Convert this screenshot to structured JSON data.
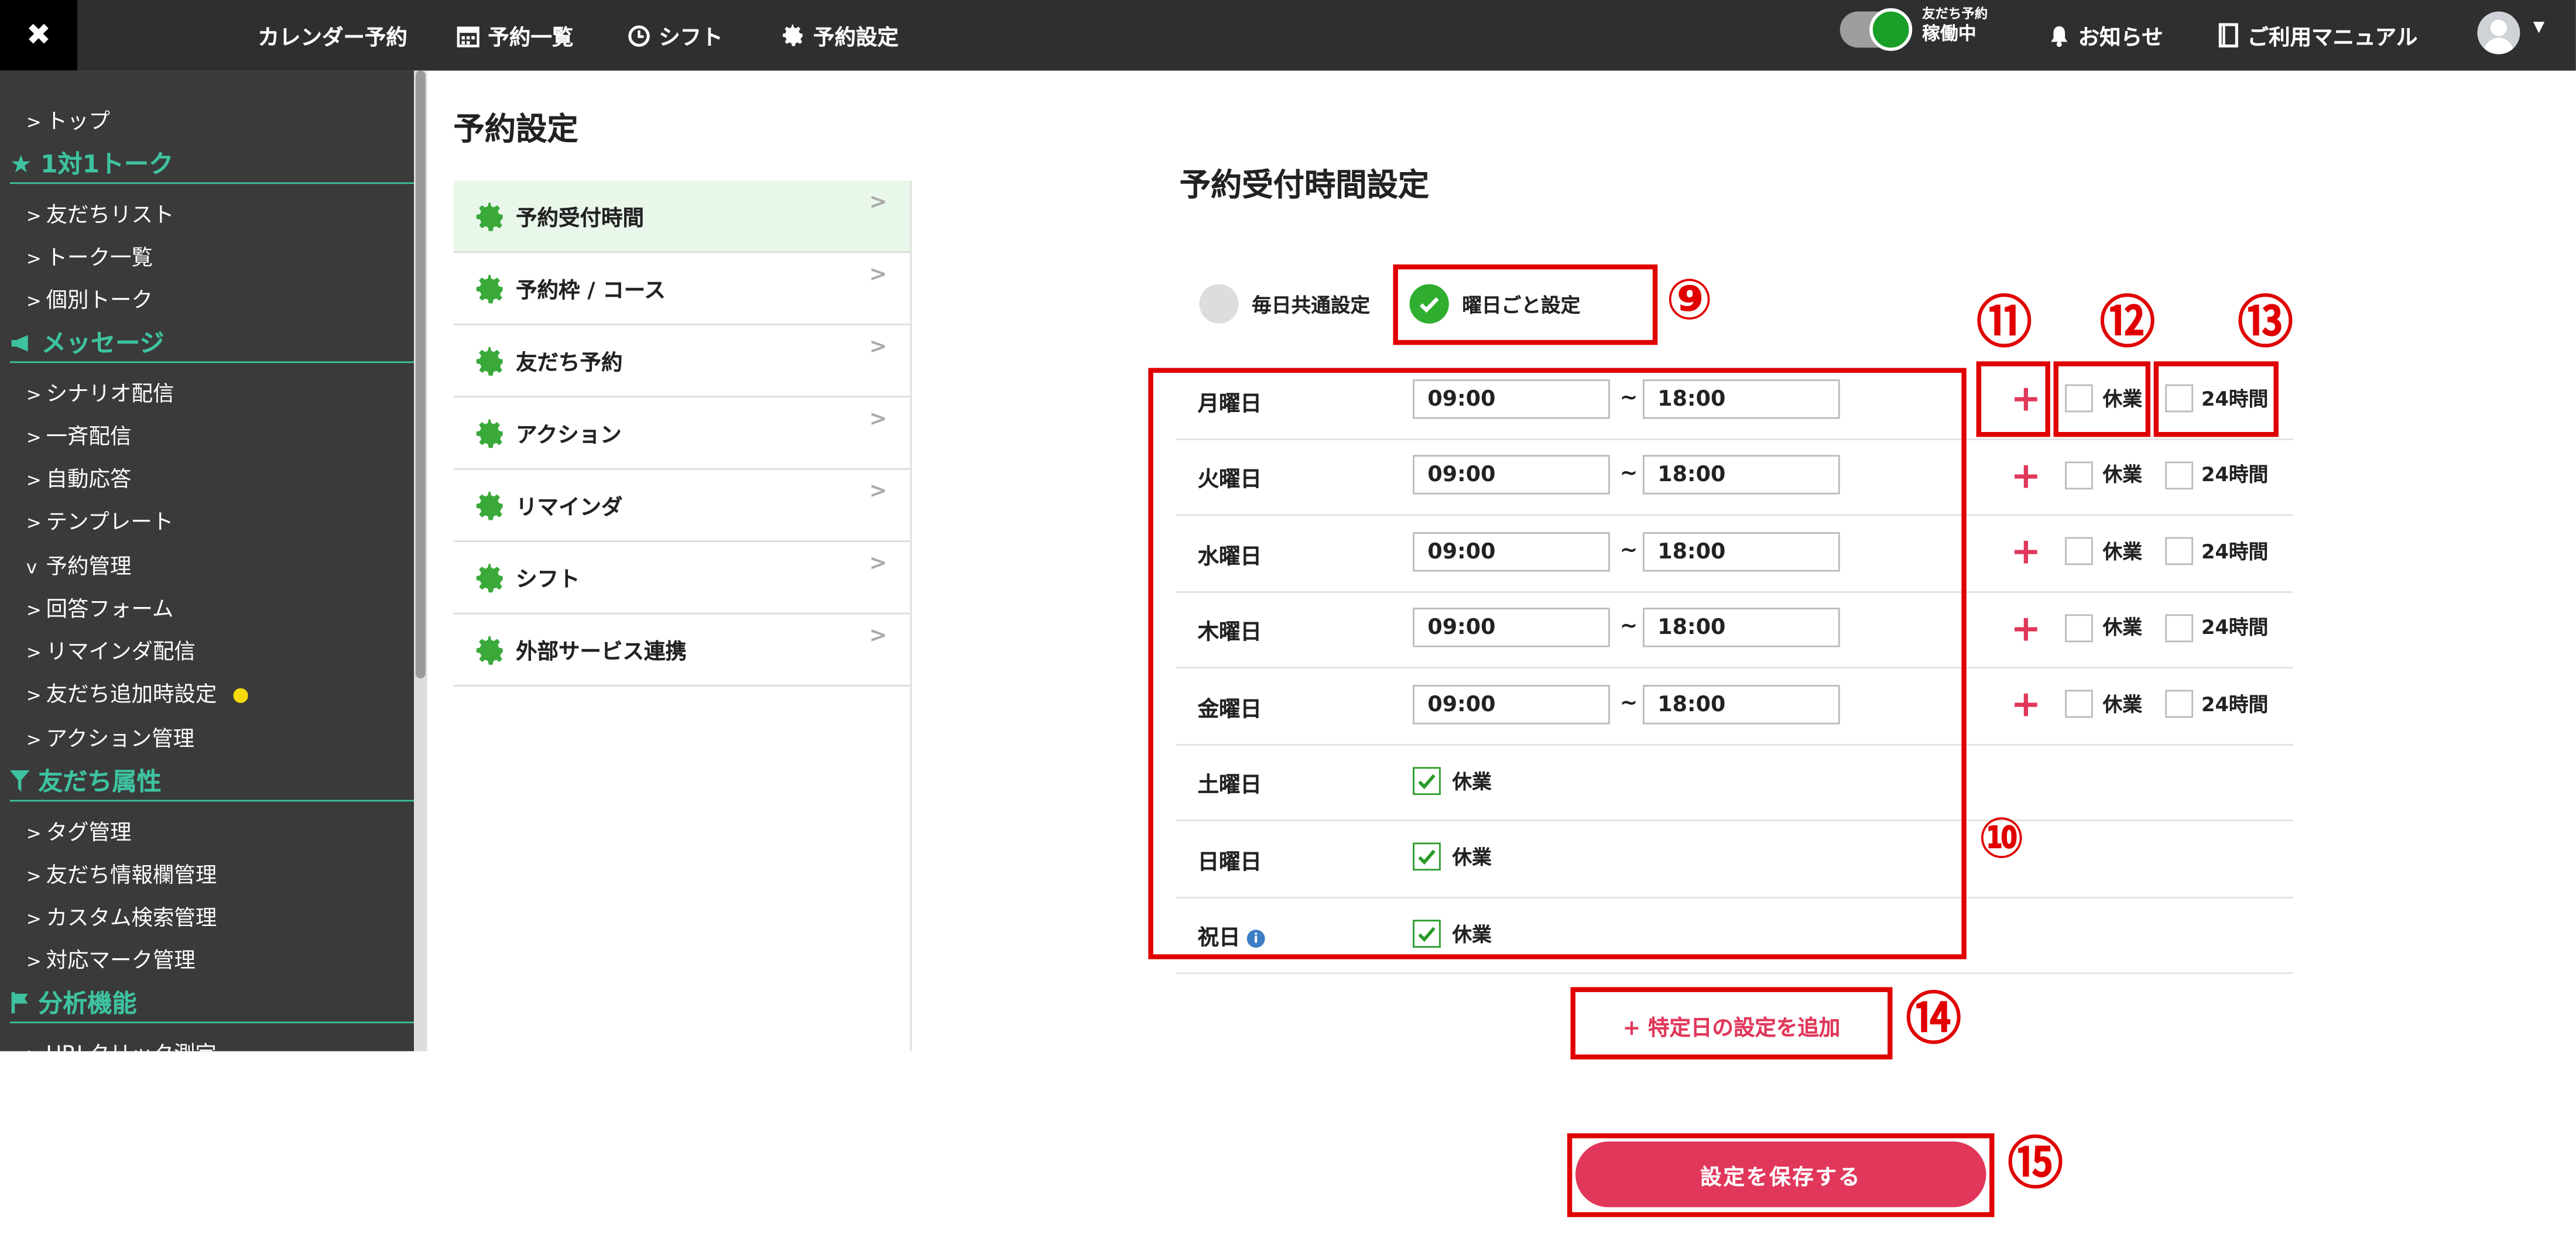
{
  "topbar": {
    "close_glyph": "✖",
    "nav": [
      {
        "label": "カレンダー予約",
        "icon": ""
      },
      {
        "label": "予約一覧",
        "icon": "calendar-icon"
      },
      {
        "label": "シフト",
        "icon": "clock-icon"
      },
      {
        "label": "予約設定",
        "icon": "gear-icon"
      }
    ],
    "status_small": "友だち予約",
    "status_big": "稼働中",
    "notice_label": "お知らせ",
    "manual_label": "ご利用マニュアル"
  },
  "sidebar": {
    "top": "トップ",
    "section_talk": "1対1トーク",
    "friend_list": "友だちリスト",
    "talk_list": "トーク一覧",
    "individual_talk": "個別トーク",
    "section_message": "メッセージ",
    "scenario": "シナリオ配信",
    "broadcast": "一斉配信",
    "auto_reply": "自動応答",
    "template": "テンプレート",
    "reservation": "予約管理",
    "answer_form": "回答フォーム",
    "remind": "リマインダ配信",
    "friend_add": "友だち追加時設定",
    "action": "アクション管理",
    "section_attr": "友だち属性",
    "tag": "タグ管理",
    "friend_info": "友だち情報欄管理",
    "custom_search": "カスタム検索管理",
    "mark": "対応マーク管理",
    "section_analysis": "分析機能",
    "url_click": "URLクリック測定"
  },
  "page_title": "予約設定",
  "submenu": [
    "予約受付時間",
    "予約枠 / コース",
    "友だち予約",
    "アクション",
    "リマインダ",
    "シフト",
    "外部サービス連携"
  ],
  "section_title": "予約受付時間設定",
  "mode_common": "毎日共通設定",
  "mode_weekday": "曜日ごと設定",
  "days": [
    {
      "name": "月曜日",
      "start": "09:00",
      "end": "18:00",
      "closed": false
    },
    {
      "name": "火曜日",
      "start": "09:00",
      "end": "18:00",
      "closed": false
    },
    {
      "name": "水曜日",
      "start": "09:00",
      "end": "18:00",
      "closed": false
    },
    {
      "name": "木曜日",
      "start": "09:00",
      "end": "18:00",
      "closed": false
    },
    {
      "name": "金曜日",
      "start": "09:00",
      "end": "18:00",
      "closed": false
    },
    {
      "name": "土曜日",
      "closed": true
    },
    {
      "name": "日曜日",
      "closed": true
    },
    {
      "name": "祝日",
      "closed": true
    }
  ],
  "tilde": "~",
  "closed_label": "休業",
  "allday_label": "24時間",
  "plus_glyph": "+",
  "add_special_label": "+ 特定日の設定を追加",
  "save_label": "設定を保存する",
  "annotations": [
    "⑨",
    "⑩",
    "⑪",
    "⑫",
    "⑬",
    "⑭",
    "⑮"
  ],
  "colors": {
    "accent": "#e0375a",
    "green": "#2fae2f",
    "sidebar_accent": "#3ec2a0",
    "annotation": "#e00000"
  }
}
